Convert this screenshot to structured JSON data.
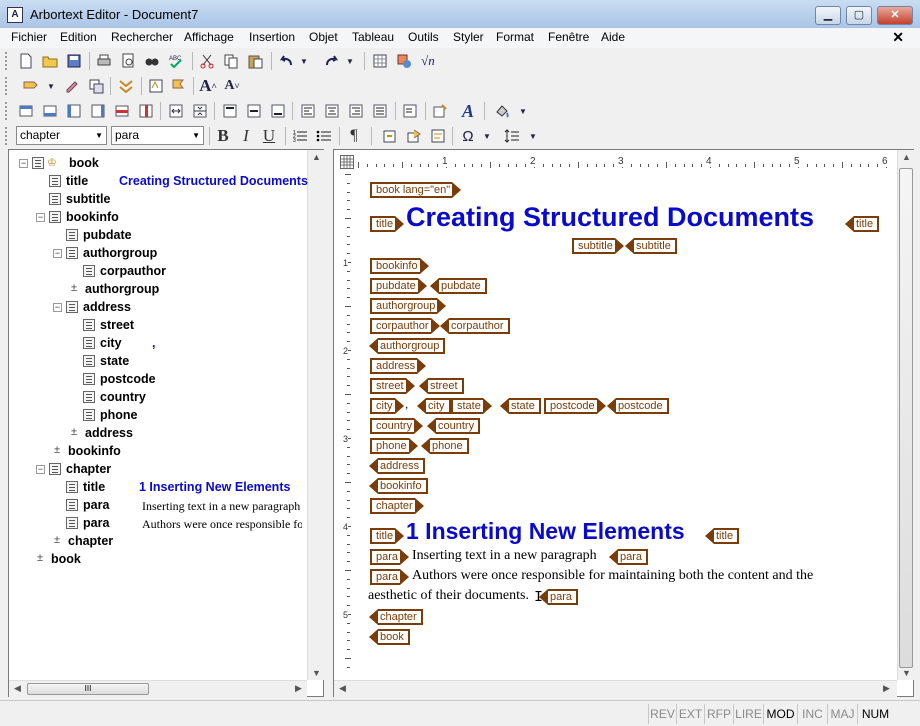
{
  "window": {
    "app_icon": "A",
    "title": "Arbortext Editor - Document7",
    "minimize": "▁",
    "maximize": "▢",
    "close": "✕"
  },
  "menu": {
    "items": [
      "Fichier",
      "Edition",
      "Rechercher",
      "Affichage",
      "Insertion",
      "Objet",
      "Tableau",
      "Outils",
      "Styler",
      "Format",
      "Fenêtre",
      "Aide"
    ],
    "close_doc": "✕"
  },
  "toolbar": {
    "element_select": "chapter",
    "style_select": "para",
    "bold": "B",
    "italic": "I",
    "underline": "U",
    "pilcrow": "¶",
    "omega": "Ω"
  },
  "tree": {
    "rows": [
      {
        "label": "book"
      },
      {
        "label": "title",
        "value": "Creating Structured Documents"
      },
      {
        "label": "subtitle"
      },
      {
        "label": "bookinfo"
      },
      {
        "label": "pubdate"
      },
      {
        "label": "authorgroup"
      },
      {
        "label": "corpauthor"
      },
      {
        "label": "authorgroup"
      },
      {
        "label": "address"
      },
      {
        "label": "street"
      },
      {
        "label": "city",
        "value": ","
      },
      {
        "label": "state"
      },
      {
        "label": "postcode"
      },
      {
        "label": "country"
      },
      {
        "label": "phone"
      },
      {
        "label": "address"
      },
      {
        "label": "bookinfo"
      },
      {
        "label": "chapter"
      },
      {
        "label": "title",
        "value": "1  Inserting New Elements"
      },
      {
        "label": "para",
        "text": "Inserting text in a new paragraph"
      },
      {
        "label": "para",
        "text": "Authors were once responsible fo"
      },
      {
        "label": "chapter"
      },
      {
        "label": "book"
      }
    ],
    "toggle_minus": "−",
    "end_marker": "±",
    "hscroll_grip": "III"
  },
  "ruler": {
    "numbers": [
      "1",
      "2",
      "3",
      "4",
      "5",
      "6"
    ],
    "vnumbers": [
      "1",
      "2",
      "3",
      "4",
      "5"
    ]
  },
  "document": {
    "tags": {
      "book_start": "book lang=\"en\"",
      "title": "title",
      "subtitle": "subtitle",
      "bookinfo": "bookinfo",
      "pubdate": "pubdate",
      "authorgroup": "authorgroup",
      "corpauthor": "corpauthor",
      "address": "address",
      "street": "street",
      "city": "city",
      "state": "state",
      "postcode": "postcode",
      "country": "country",
      "phone": "phone",
      "chapter": "chapter",
      "para": "para",
      "book": "book"
    },
    "book_title": "Creating Structured Documents",
    "city_comma": ",",
    "chapter_title": "1  Inserting New Elements",
    "para1": "Inserting text in a new paragraph",
    "para2_line1": "Authors were once responsible for maintaining both the content and the",
    "para2_line2": "aesthetic of their documents."
  },
  "status": {
    "items": [
      "REV",
      "EXT",
      "RFP",
      "LIRE",
      "MOD",
      "INC",
      "MAJ",
      "NUM"
    ],
    "active": [
      "MOD",
      "NUM"
    ]
  },
  "colors": {
    "tag_brown": "#7a3d08",
    "title_blue": "#0a0acc"
  }
}
